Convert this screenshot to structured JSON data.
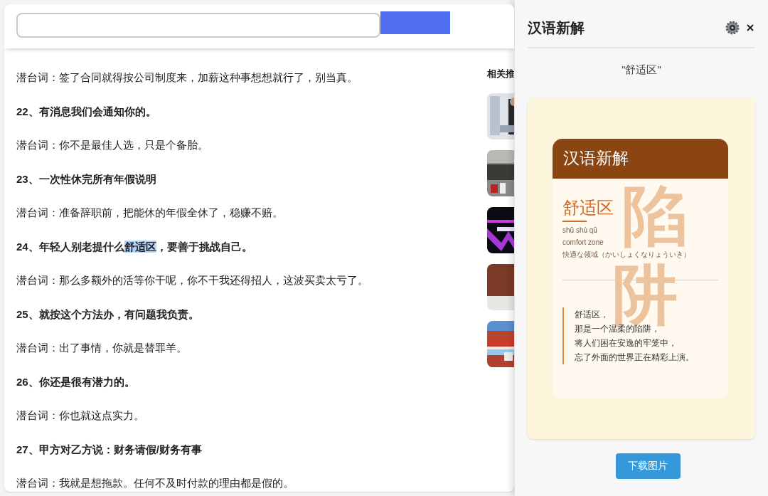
{
  "article": {
    "lines": [
      {
        "kind": "plain",
        "text": "潜台词：签了合同就得按公司制度来，加薪这种事想想就行了，别当真。"
      },
      {
        "kind": "heading",
        "text": "22、有消息我们会通知你的。"
      },
      {
        "kind": "plain",
        "text": "潜台词：你不是最佳人选，只是个备胎。"
      },
      {
        "kind": "heading",
        "text": "23、一次性休完所有年假说明"
      },
      {
        "kind": "plain",
        "text": "潜台词：准备辞职前，把能休的年假全休了，稳赚不赔。"
      },
      {
        "kind": "heading",
        "text": "24、年轻人别老提什么",
        "highlight": "舒适区",
        "after": "，要善于挑战自己。"
      },
      {
        "kind": "plain",
        "text": "潜台词：那么多额外的活等你干呢，你不干我还得招人，这波买卖太亏了。"
      },
      {
        "kind": "heading",
        "text": "25、就按这个方法办，有问题我负责。"
      },
      {
        "kind": "plain",
        "text": "潜台词：出了事情，你就是替罪羊。"
      },
      {
        "kind": "heading",
        "text": "26、你还是很有潜力的。"
      },
      {
        "kind": "plain",
        "text": "潜台词：你也就这点实力。"
      },
      {
        "kind": "heading",
        "text": "27、甲方对乙方说：财务请假/财务有事"
      },
      {
        "kind": "plain",
        "text": "潜台词：我就是想拖款。任何不及时付款的理由都是假的。"
      }
    ]
  },
  "related": {
    "title": "相关推"
  },
  "panel": {
    "title": "汉语新解",
    "query": "\"舒适区\"",
    "card": {
      "header": "汉语新解",
      "decor": [
        "陷",
        "阱"
      ],
      "word": "舒适区",
      "pinyin": "shū shù qū",
      "english": "comfort zone",
      "japanese": "快適な领域（かいしょくなりょういき）",
      "quote": [
        "舒适区，",
        "那是一个温柔的陷阱，",
        "将人们困在安逸的牢笼中，",
        "忘了外面的世界正在精彩上演。"
      ]
    },
    "download_button": "下载图片"
  }
}
